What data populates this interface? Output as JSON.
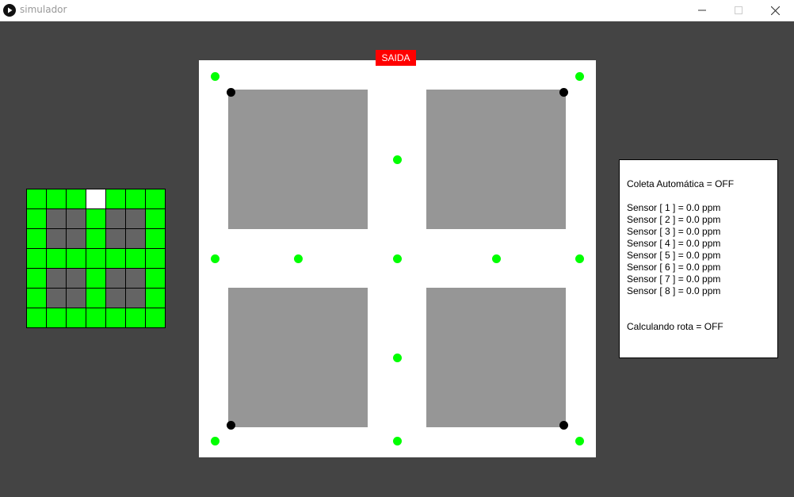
{
  "window": {
    "title": "simulador"
  },
  "minimap": {
    "colors": {
      "path": "#00ff00",
      "block": "#646464",
      "exit": "#ffffff"
    },
    "rows": [
      [
        "path",
        "path",
        "path",
        "exit",
        "path",
        "path",
        "path"
      ],
      [
        "path",
        "block",
        "block",
        "path",
        "block",
        "block",
        "path"
      ],
      [
        "path",
        "block",
        "block",
        "path",
        "block",
        "block",
        "path"
      ],
      [
        "path",
        "path",
        "path",
        "path",
        "path",
        "path",
        "path"
      ],
      [
        "path",
        "block",
        "block",
        "path",
        "block",
        "block",
        "path"
      ],
      [
        "path",
        "block",
        "block",
        "path",
        "block",
        "block",
        "path"
      ],
      [
        "path",
        "path",
        "path",
        "path",
        "path",
        "path",
        "path"
      ]
    ]
  },
  "arena": {
    "exit_label": "SAIDA",
    "colors": {
      "node_active": "#00ff00",
      "node_sensor": "#000000",
      "block": "#969696"
    }
  },
  "panel": {
    "auto_collect": "Coleta Automática = OFF",
    "sensors": [
      "Sensor [ 1 ] = 0.0 ppm",
      "Sensor [ 2 ] = 0.0 ppm",
      "Sensor [ 3 ] = 0.0 ppm",
      "Sensor [ 4 ] = 0.0 ppm",
      "Sensor [ 5 ] = 0.0 ppm",
      "Sensor [ 6 ] = 0.0 ppm",
      "Sensor [ 7 ] = 0.0 ppm",
      "Sensor [ 8 ] = 0.0 ppm"
    ],
    "route_status": "Calculando rota = OFF"
  }
}
